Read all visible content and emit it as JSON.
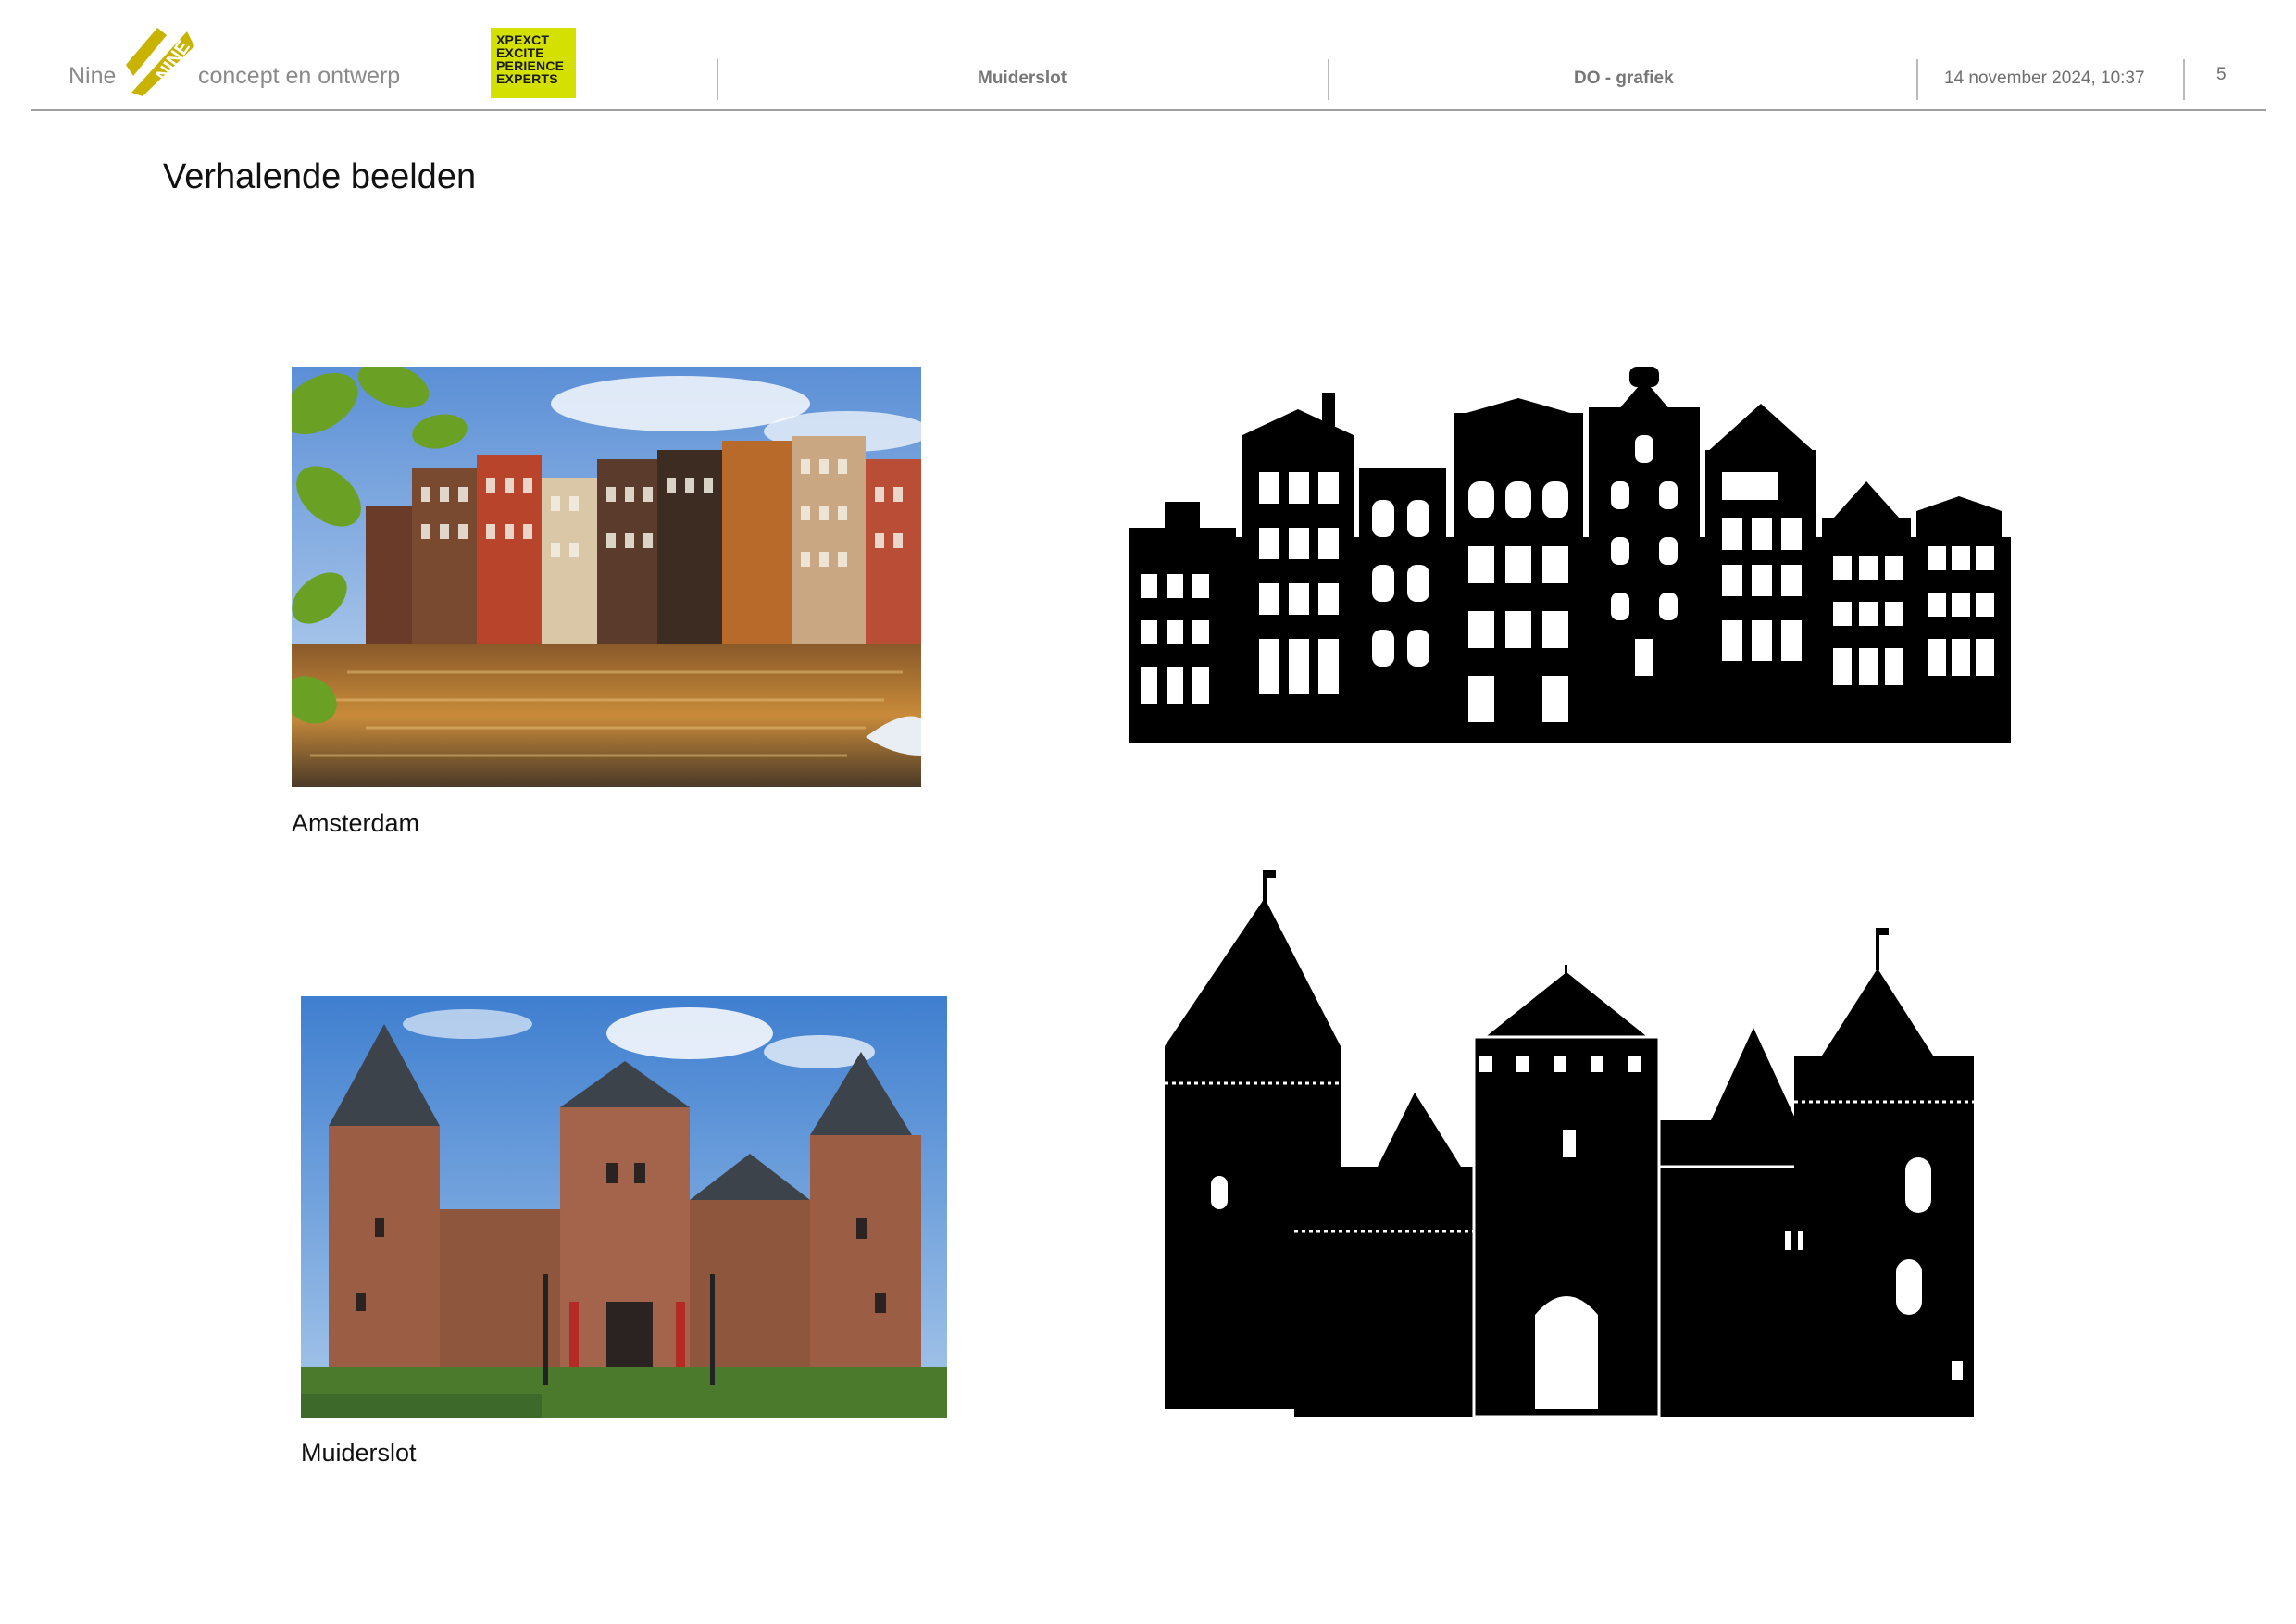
{
  "header": {
    "brand_left": "Nine",
    "brand_logo_text": "NINE",
    "brand_right": "concept en ontwerp",
    "xpexct_lines": [
      "XPEXCT",
      "EXCITE",
      "PERIENCE",
      "EXPERTS"
    ],
    "project": "Muiderslot",
    "phase": "DO - grafiek",
    "datetime": "14 november 2024, 10:37",
    "page_number": "5"
  },
  "page": {
    "title": "Verhalende beelden"
  },
  "images": [
    {
      "caption": "Amsterdam"
    },
    {
      "caption": "Muiderslot"
    }
  ],
  "colors": {
    "brand_yellow": "#d4e000",
    "nine_logo": "#c8b400",
    "silhouette": "#000000"
  }
}
